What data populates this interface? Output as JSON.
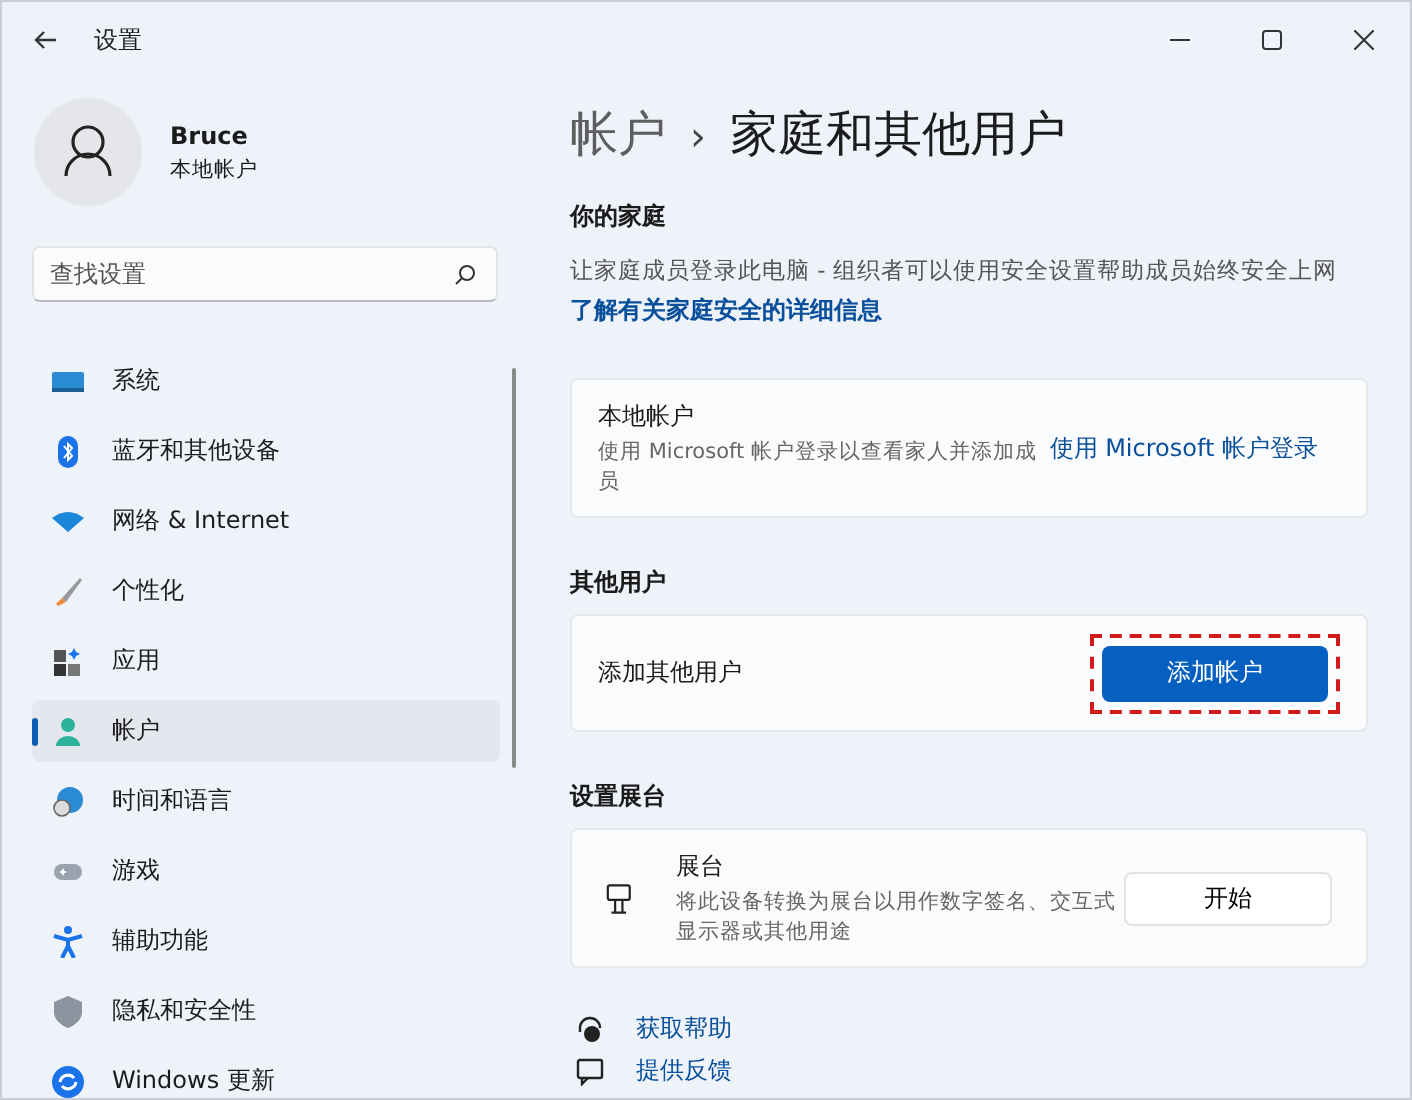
{
  "window": {
    "title": "设置"
  },
  "user": {
    "name": "Bruce",
    "account_type": "本地帐户"
  },
  "search": {
    "placeholder": "查找设置"
  },
  "nav": [
    {
      "label": "系统",
      "selected": false
    },
    {
      "label": "蓝牙和其他设备",
      "selected": false
    },
    {
      "label": "网络 & Internet",
      "selected": false
    },
    {
      "label": "个性化",
      "selected": false
    },
    {
      "label": "应用",
      "selected": false
    },
    {
      "label": "帐户",
      "selected": true
    },
    {
      "label": "时间和语言",
      "selected": false
    },
    {
      "label": "游戏",
      "selected": false
    },
    {
      "label": "辅助功能",
      "selected": false
    },
    {
      "label": "隐私和安全性",
      "selected": false
    },
    {
      "label": "Windows 更新",
      "selected": false
    }
  ],
  "breadcrumb": {
    "parent": "帐户",
    "separator": "›",
    "current": "家庭和其他用户"
  },
  "family": {
    "heading": "你的家庭",
    "description": "让家庭成员登录此电脑 - 组织者可以使用安全设置帮助成员始终安全上网",
    "link": "了解有关家庭安全的详细信息",
    "card": {
      "title": "本地帐户",
      "description": "使用 Microsoft 帐户登录以查看家人并添加成员",
      "action": "使用 Microsoft 帐户登录"
    }
  },
  "other_users": {
    "heading": "其他用户",
    "label": "添加其他用户",
    "button": "添加帐户",
    "highlighted": true
  },
  "kiosk": {
    "heading": "设置展台",
    "title": "展台",
    "description": "将此设备转换为展台以用作数字签名、交互式显示器或其他用途",
    "button": "开始"
  },
  "help_links": [
    "获取帮助",
    "提供反馈"
  ]
}
